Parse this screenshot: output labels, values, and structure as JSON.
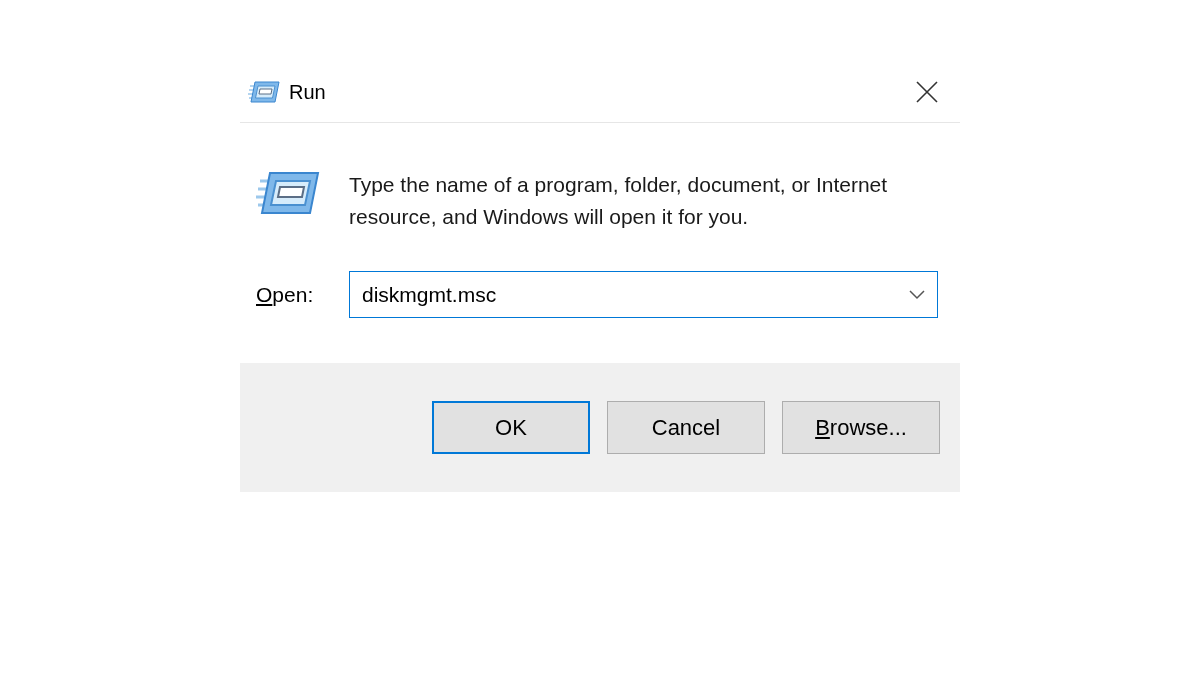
{
  "window": {
    "title": "Run"
  },
  "message": "Type the name of a program, folder, document, or Internet resource, and Windows will open it for you.",
  "open_field": {
    "access_key": "O",
    "label_rest": "pen:",
    "value": "diskmgmt.msc",
    "focused": true
  },
  "buttons": [
    {
      "label_rest": "OK",
      "default": true
    },
    {
      "label_rest": "Cancel",
      "default": false
    },
    {
      "access_key": "B",
      "label_rest": "rowse...",
      "default": false
    }
  ]
}
